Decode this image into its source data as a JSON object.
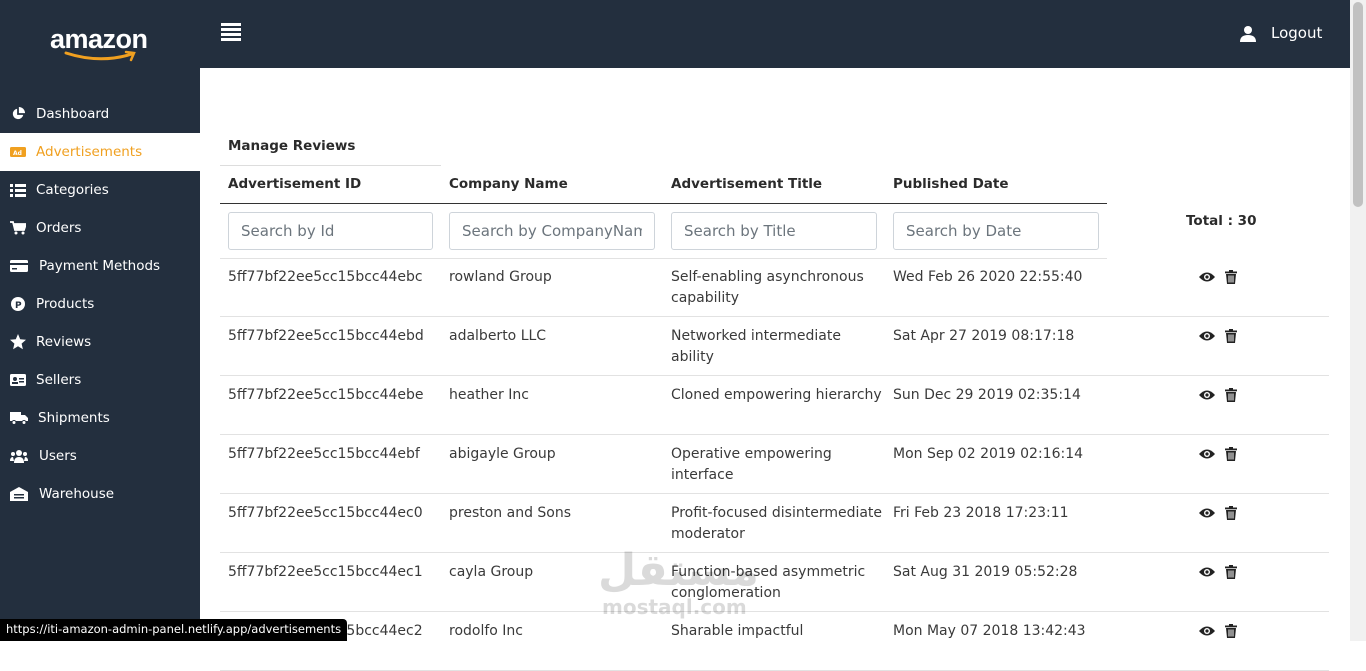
{
  "brand": {
    "logo_text": "amazon",
    "accent": "#f0a020",
    "nav_bg": "#232f3e"
  },
  "header": {
    "menu_icon": "hamburger-icon",
    "user_icon": "user-icon",
    "logout_label": "Logout"
  },
  "sidebar": {
    "items": [
      {
        "label": "Dashboard",
        "icon": "pie-chart-icon",
        "active": false
      },
      {
        "label": "Advertisements",
        "icon": "ad-icon",
        "active": true
      },
      {
        "label": "Categories",
        "icon": "list-icon",
        "active": false
      },
      {
        "label": "Orders",
        "icon": "cart-icon",
        "active": false
      },
      {
        "label": "Payment Methods",
        "icon": "credit-card-icon",
        "active": false
      },
      {
        "label": "Products",
        "icon": "product-icon",
        "active": false
      },
      {
        "label": "Reviews",
        "icon": "star-icon",
        "active": false
      },
      {
        "label": "Sellers",
        "icon": "id-card-icon",
        "active": false
      },
      {
        "label": "Shipments",
        "icon": "truck-icon",
        "active": false
      },
      {
        "label": "Users",
        "icon": "users-icon",
        "active": false
      },
      {
        "label": "Warehouse",
        "icon": "warehouse-icon",
        "active": false
      }
    ]
  },
  "main": {
    "section_title": "Manage Reviews",
    "columns": [
      "Advertisement ID",
      "Company Name",
      "Advertisement Title",
      "Published Date"
    ],
    "search": {
      "id_placeholder": "Search by Id",
      "company_placeholder": "Search by CompanyName",
      "title_placeholder": "Search by Title",
      "date_placeholder": "Search by Date"
    },
    "total_label": "Total : 30",
    "rows": [
      {
        "id": "5ff77bf22ee5cc15bcc44ebc",
        "company": "rowland Group",
        "title": "Self-enabling asynchronous capability",
        "date": "Wed Feb 26 2020 22:55:40"
      },
      {
        "id": "5ff77bf22ee5cc15bcc44ebd",
        "company": "adalberto LLC",
        "title": "Networked intermediate ability",
        "date": "Sat Apr 27 2019 08:17:18"
      },
      {
        "id": "5ff77bf22ee5cc15bcc44ebe",
        "company": "heather Inc",
        "title": "Cloned empowering hierarchy",
        "date": "Sun Dec 29 2019 02:35:14"
      },
      {
        "id": "5ff77bf22ee5cc15bcc44ebf",
        "company": "abigayle Group",
        "title": "Operative empowering interface",
        "date": "Mon Sep 02 2019 02:16:14"
      },
      {
        "id": "5ff77bf22ee5cc15bcc44ec0",
        "company": "preston and Sons",
        "title": "Profit-focused disintermediate moderator",
        "date": "Fri Feb 23 2018 17:23:11"
      },
      {
        "id": "5ff77bf22ee5cc15bcc44ec1",
        "company": "cayla Group",
        "title": "Function-based asymmetric conglomeration",
        "date": "Sat Aug 31 2019 05:52:28"
      },
      {
        "id": "5ff77bf22ee5cc15bcc44ec2",
        "company": "rodolfo Inc",
        "title": "Sharable impactful",
        "date": "Mon May 07 2018 13:42:43"
      }
    ]
  },
  "watermark": {
    "arabic": "مستقل",
    "latin": "mostaql.com"
  },
  "status_bar": {
    "url": "https://iti-amazon-admin-panel.netlify.app/advertisements"
  }
}
